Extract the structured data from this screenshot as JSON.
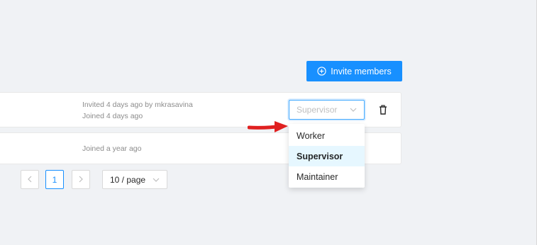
{
  "toolbar": {
    "invite_label": "Invite members",
    "invite_icon": "plus-circle-icon"
  },
  "members": [
    {
      "invited": "Invited 4 days ago by mkrasavina",
      "joined": "Joined 4 days ago",
      "role_placeholder": "Supervisor"
    },
    {
      "joined": "Joined a year ago"
    }
  ],
  "role_dropdown": {
    "options": [
      "Worker",
      "Supervisor",
      "Maintainer"
    ],
    "selected": "Supervisor"
  },
  "pagination": {
    "current_page": "1",
    "page_size": "10 / page"
  },
  "colors": {
    "primary": "#1890ff",
    "annotation_arrow": "#e02020",
    "selected_bg": "#e6f7ff"
  }
}
